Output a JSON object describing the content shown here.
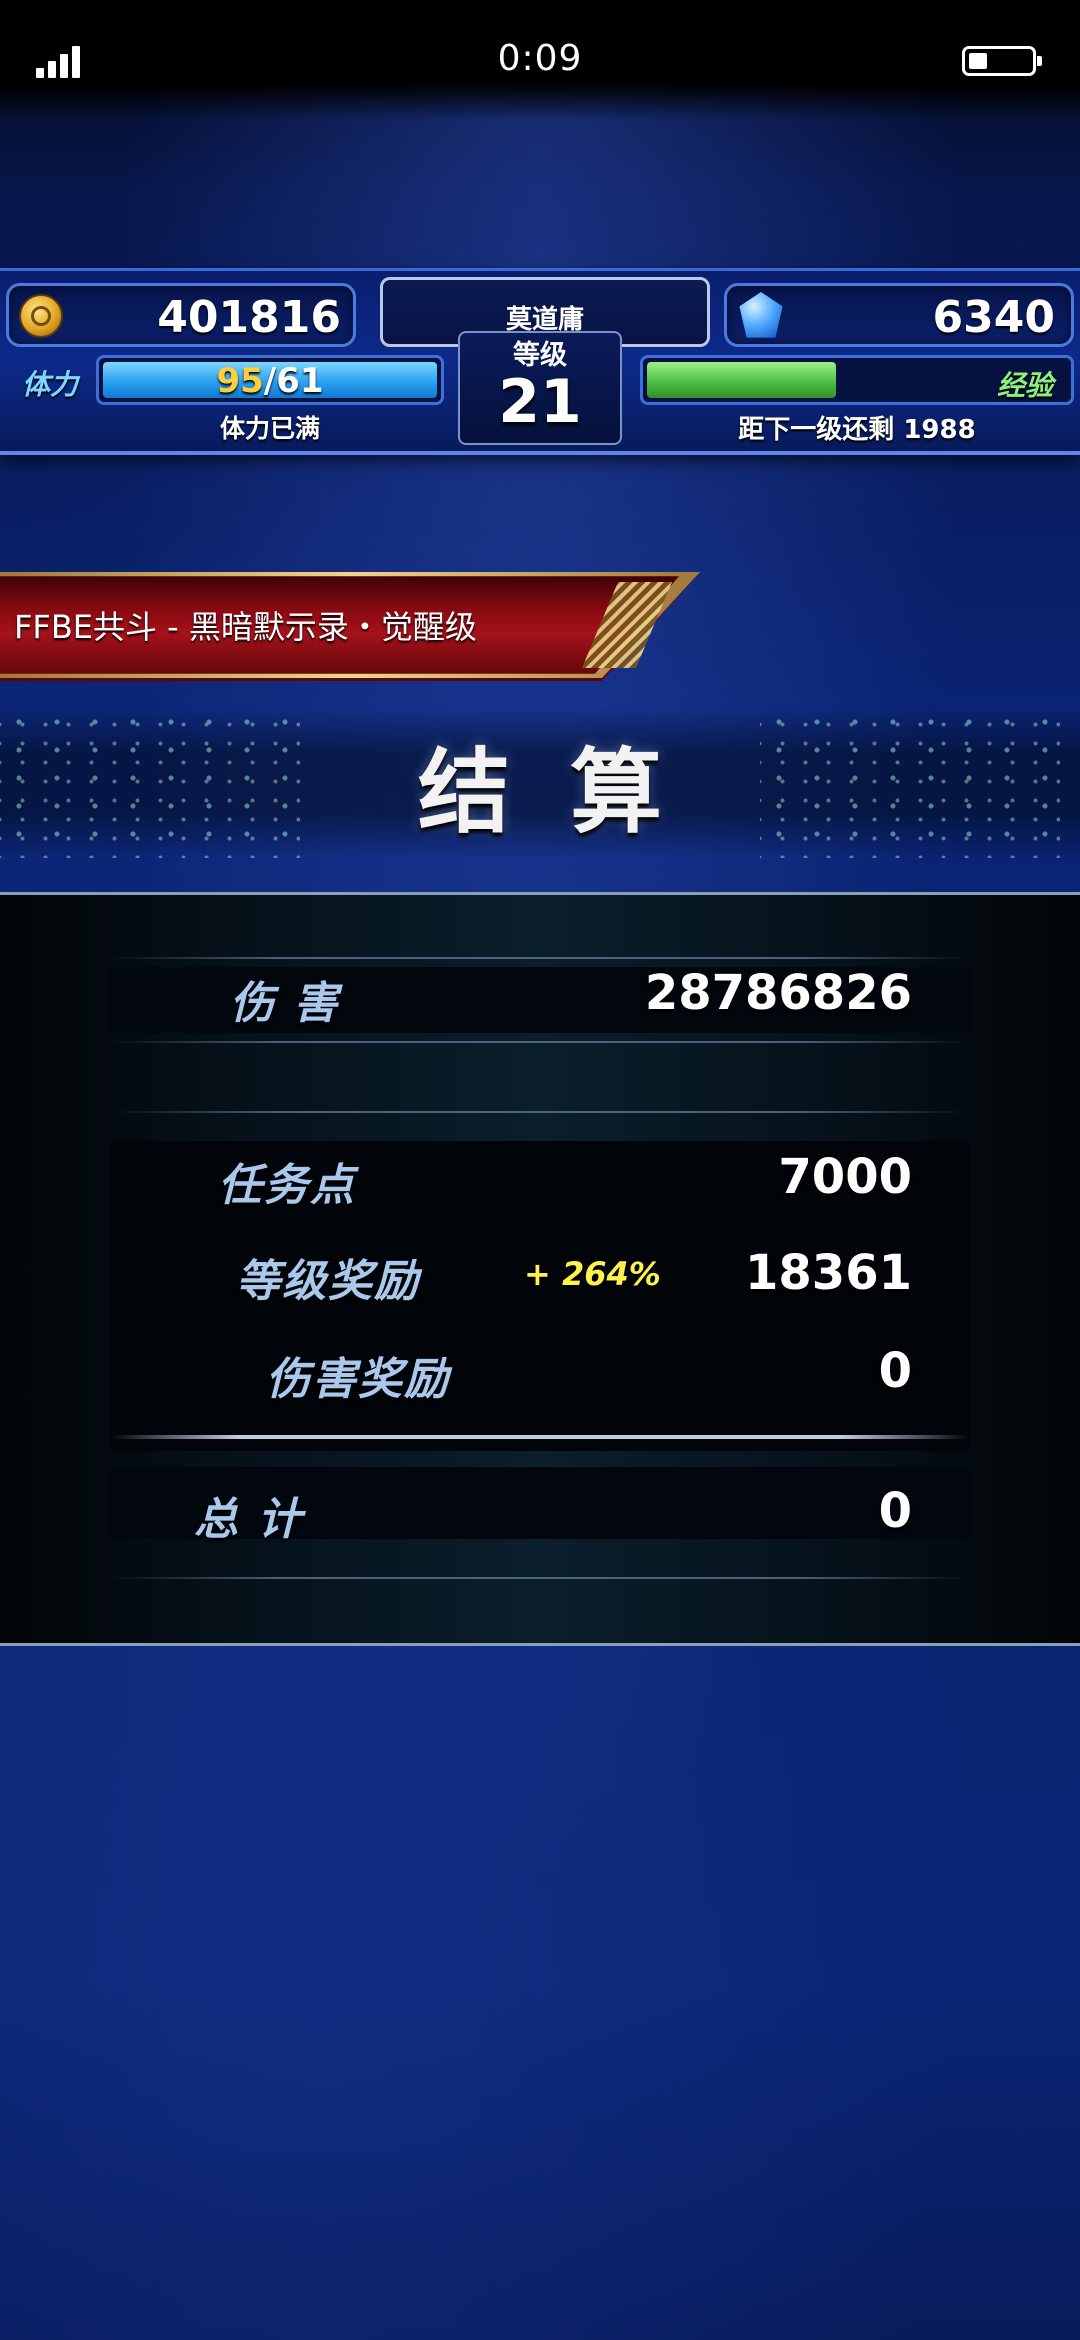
{
  "status_bar": {
    "time": "0:09"
  },
  "hud": {
    "gil": "401816",
    "lapis": "6340",
    "player_name": "莫道庸",
    "level_label": "等级",
    "level": "21",
    "stamina_label": "体力",
    "stamina_current": "95",
    "stamina_max": "/61",
    "stamina_status": "体力已满",
    "exp_label": "经验",
    "exp_remaining": "距下一级还剩 1988",
    "exp_progress_fraction": 0.45,
    "stamina_progress_fraction": 1.0
  },
  "quest": {
    "title": "FFBE共斗 - 黑暗默示录・觉醒级"
  },
  "results": {
    "title": "结算",
    "damage_label": "伤 害",
    "damage_value": "28786826",
    "mission_points_label": "任务点",
    "mission_points_value": "7000",
    "level_bonus_label": "等级奖励",
    "level_bonus_percent": "+ 264%",
    "level_bonus_value": "18361",
    "damage_bonus_label": "伤害奖励",
    "damage_bonus_value": "0",
    "total_label": "总 计",
    "total_value": "0"
  },
  "colors": {
    "background": "#0a2372",
    "stamina_bar": "#2aa2f2",
    "exp_bar": "#4fbf45",
    "banner_red": "#a5121a",
    "bonus_yellow": "#fff24a",
    "label_blue": "#a9c8ec"
  },
  "icons": [
    "signal-icon",
    "battery-icon",
    "gil-coin-icon",
    "lapis-gem-icon"
  ]
}
